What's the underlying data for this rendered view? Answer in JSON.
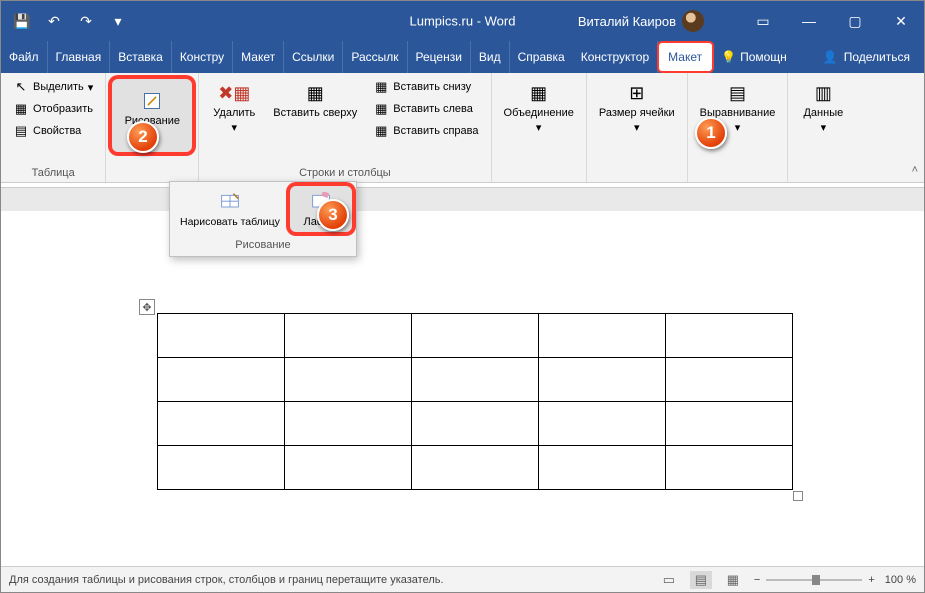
{
  "title": "Lumpics.ru  -  Word",
  "user": "Виталий Каиров",
  "win": {
    "min": "—",
    "max": "▢",
    "close": "✕"
  },
  "qat": {
    "save": "💾",
    "undo": "↶",
    "redo": "↷",
    "more": "▾"
  },
  "tabs": {
    "file": "Файл",
    "home": "Главная",
    "insert": "Вставка",
    "design": "Констру",
    "layout": "Макет",
    "refs": "Ссылки",
    "mail": "Рассылк",
    "review": "Рецензи",
    "view": "Вид",
    "help": "Справка",
    "tdesign": "Конструктор",
    "tlayout": "Макет",
    "tell": "Помощн",
    "share": "Поделиться"
  },
  "ribbon": {
    "table": {
      "select": "Выделить",
      "grid": "Отобразить",
      "props": "Свойства",
      "group": "Таблица"
    },
    "draw": {
      "btn": "Рисование",
      "drawtbl": "Нарисовать таблицу",
      "eraser": "Ластик",
      "group": "Рисование"
    },
    "delete": "Удалить",
    "insert": {
      "above": "Вставить сверху",
      "below": "Вставить снизу",
      "left": "Вставить слева",
      "right": "Вставить справа",
      "group": "Строки и столбцы"
    },
    "merge": "Объединение",
    "cellsize": "Размер ячейки",
    "align": "Выравнивание",
    "data": "Данные"
  },
  "status": {
    "text": "Для создания таблицы и рисования строк, столбцов и границ перетащите указатель.",
    "zoom": "100 %"
  },
  "markers": {
    "m1": "1",
    "m2": "2",
    "m3": "3"
  }
}
